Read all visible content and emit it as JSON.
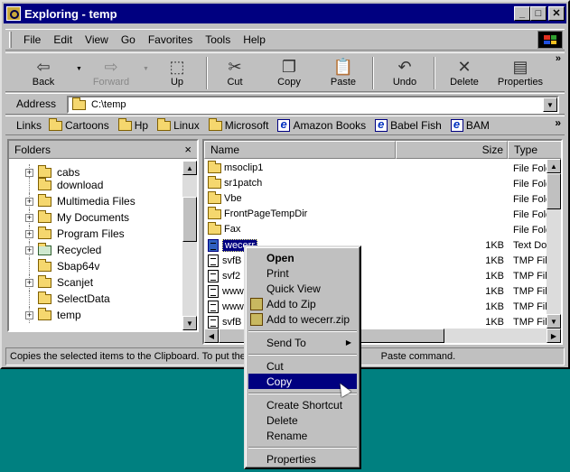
{
  "window": {
    "title": "Exploring - temp"
  },
  "menu": [
    "File",
    "Edit",
    "View",
    "Go",
    "Favorites",
    "Tools",
    "Help"
  ],
  "toolbar": {
    "back": "Back",
    "forward": "Forward",
    "up": "Up",
    "cut": "Cut",
    "copy": "Copy",
    "paste": "Paste",
    "undo": "Undo",
    "delete": "Delete",
    "properties": "Properties",
    "more": "»"
  },
  "address": {
    "label": "Address",
    "value": "C:\\temp"
  },
  "links": {
    "label": "Links",
    "items": [
      "Cartoons",
      "Hp",
      "Linux",
      "Microsoft",
      "Amazon Books",
      "Babel Fish",
      "BAM"
    ],
    "more": "»"
  },
  "folders_pane": {
    "title": "Folders",
    "close": "×",
    "items": [
      {
        "label": "cabs",
        "expander": "+"
      },
      {
        "label": "download",
        "expander": ""
      },
      {
        "label": "Multimedia Files",
        "expander": "+"
      },
      {
        "label": "My Documents",
        "expander": "+"
      },
      {
        "label": "Program Files",
        "expander": "+"
      },
      {
        "label": "Recycled",
        "expander": "+",
        "icon": "recycle-bin"
      },
      {
        "label": "Sbap64v",
        "expander": ""
      },
      {
        "label": "Scanjet",
        "expander": "+"
      },
      {
        "label": "SelectData",
        "expander": ""
      },
      {
        "label": "temp",
        "expander": "+"
      }
    ]
  },
  "file_list": {
    "columns": {
      "name": "Name",
      "size": "Size",
      "type": "Type"
    },
    "rows": [
      {
        "name": "msoclip1",
        "size": "",
        "type": "File Fold",
        "icon": "folder"
      },
      {
        "name": "sr1patch",
        "size": "",
        "type": "File Fold",
        "icon": "folder"
      },
      {
        "name": "Vbe",
        "size": "",
        "type": "File Fold",
        "icon": "folder"
      },
      {
        "name": "FrontPageTempDir",
        "size": "",
        "type": "File Fold",
        "icon": "folder"
      },
      {
        "name": "Fax",
        "size": "",
        "type": "File Fold",
        "icon": "folder"
      },
      {
        "name": "wecerr",
        "size": "1KB",
        "type": "Text Do",
        "icon": "document",
        "selected": true
      },
      {
        "name": "svfB",
        "size": "1KB",
        "type": "TMP Fil",
        "icon": "document"
      },
      {
        "name": "svf2",
        "size": "1KB",
        "type": "TMP Fil",
        "icon": "document"
      },
      {
        "name": "www",
        "size": "1KB",
        "type": "TMP Fil",
        "icon": "document"
      },
      {
        "name": "www",
        "size": "1KB",
        "type": "TMP Fil",
        "icon": "document"
      },
      {
        "name": "svfB",
        "size": "1KB",
        "type": "TMP Fil",
        "icon": "document"
      }
    ]
  },
  "status": {
    "text": "Copies the selected items to the Clipboard. To put them                                              Paste command."
  },
  "context_menu": {
    "open": "Open",
    "print": "Print",
    "quick_view": "Quick View",
    "add_zip": "Add to Zip",
    "add_to_named_zip": "Add to wecerr.zip",
    "send_to": "Send To",
    "cut": "Cut",
    "copy": "Copy",
    "create_shortcut": "Create Shortcut",
    "delete": "Delete",
    "rename": "Rename",
    "properties": "Properties"
  },
  "colors": {
    "titlebar": "#000080",
    "desktop": "#008080",
    "face": "#c0c0c0",
    "highlight": "#000080"
  }
}
